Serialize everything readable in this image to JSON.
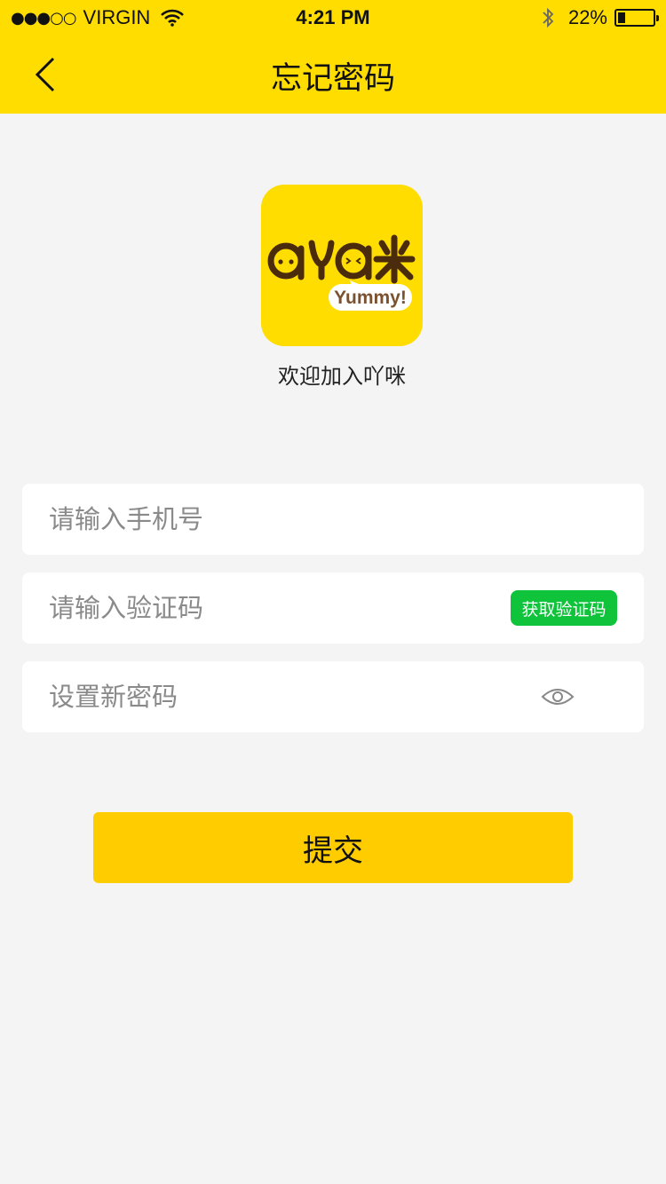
{
  "status_bar": {
    "signal": "●●●○○",
    "carrier": "VIRGIN",
    "time": "4:21 PM",
    "battery_percent": "22%",
    "battery_level": 0.22,
    "icons": [
      "wifi-icon",
      "bluetooth-icon",
      "battery-icon"
    ]
  },
  "nav": {
    "title": "忘记密码",
    "back_icon": "chevron-left-icon"
  },
  "logo": {
    "wordmark": "aYa米",
    "tagline": "Yummy!",
    "bg_color": "#ffdd00",
    "ink_color": "#4a2c0c"
  },
  "welcome_text": "欢迎加入吖咪",
  "form": {
    "phone_placeholder": "请输入手机号",
    "code_placeholder": "请输入验证码",
    "get_code_label": "获取验证码",
    "password_placeholder": "设置新密码",
    "password_toggle_icon": "eye-icon",
    "submit_label": "提交"
  },
  "colors": {
    "header": "#ffdd00",
    "background": "#f4f4f4",
    "code_button": "#0fc43b",
    "submit_button": "#ffcc00"
  }
}
